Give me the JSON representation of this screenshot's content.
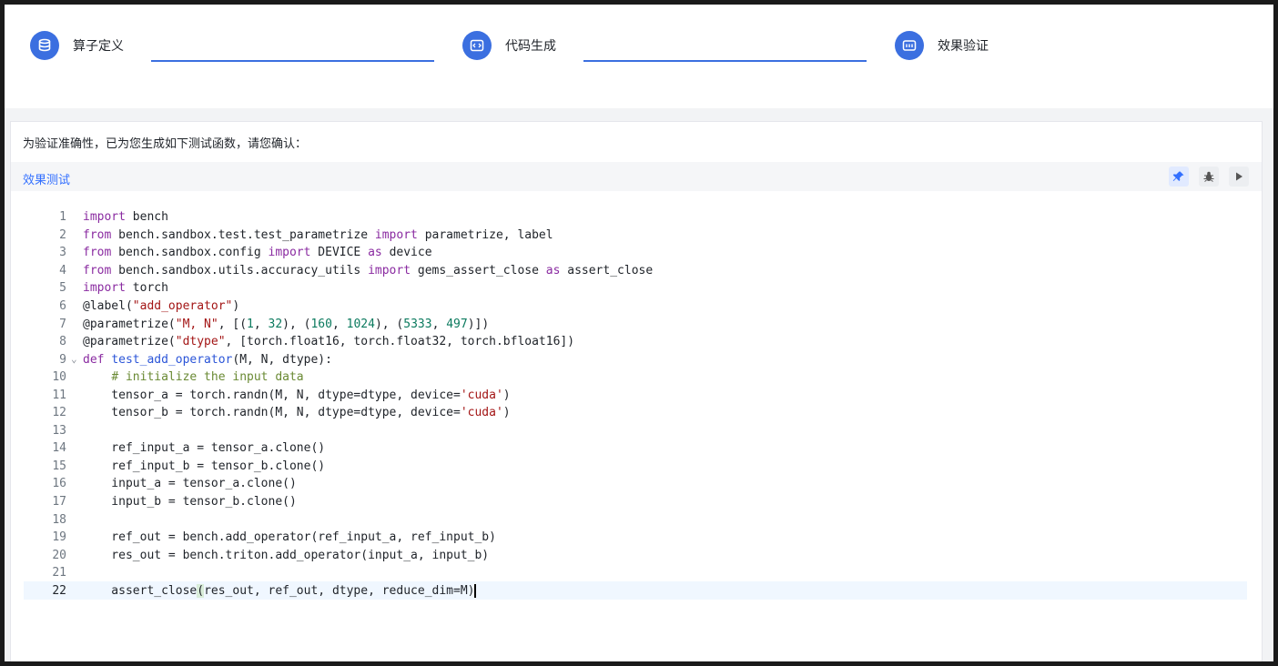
{
  "steps": [
    {
      "label": "算子定义",
      "icon": "database-icon"
    },
    {
      "label": "代码生成",
      "icon": "code-icon"
    },
    {
      "label": "效果验证",
      "icon": "verify-icon"
    }
  ],
  "colors": {
    "accent": "#3b6fe0",
    "tab": "#3370ff"
  },
  "prompt": "为验证准确性，已为您生成如下测试函数，请您确认：",
  "tab": {
    "label": "效果测试"
  },
  "toolbar": [
    "pin-icon",
    "debug-icon",
    "run-icon"
  ],
  "code": {
    "active_line": 22,
    "lines": [
      "import bench",
      "from bench.sandbox.test.test_parametrize import parametrize, label",
      "from bench.sandbox.config import DEVICE as device",
      "from bench.sandbox.utils.accuracy_utils import gems_assert_close as assert_close",
      "import torch",
      "@label(\"add_operator\")",
      "@parametrize(\"M, N\", [(1, 32), (160, 1024), (5333, 497)])",
      "@parametrize(\"dtype\", [torch.float16, torch.float32, torch.bfloat16])",
      "def test_add_operator(M, N, dtype):",
      "    # initialize the input data",
      "    tensor_a = torch.randn(M, N, dtype=dtype, device='cuda')",
      "    tensor_b = torch.randn(M, N, dtype=dtype, device='cuda')",
      "",
      "    ref_input_a = tensor_a.clone()",
      "    ref_input_b = tensor_b.clone()",
      "    input_a = tensor_a.clone()",
      "    input_b = tensor_b.clone()",
      "",
      "    ref_out = bench.add_operator(ref_input_a, ref_input_b)",
      "    res_out = bench.triton.add_operator(input_a, input_b)",
      "",
      "    assert_close(res_out, ref_out, dtype, reduce_dim=M)"
    ]
  }
}
